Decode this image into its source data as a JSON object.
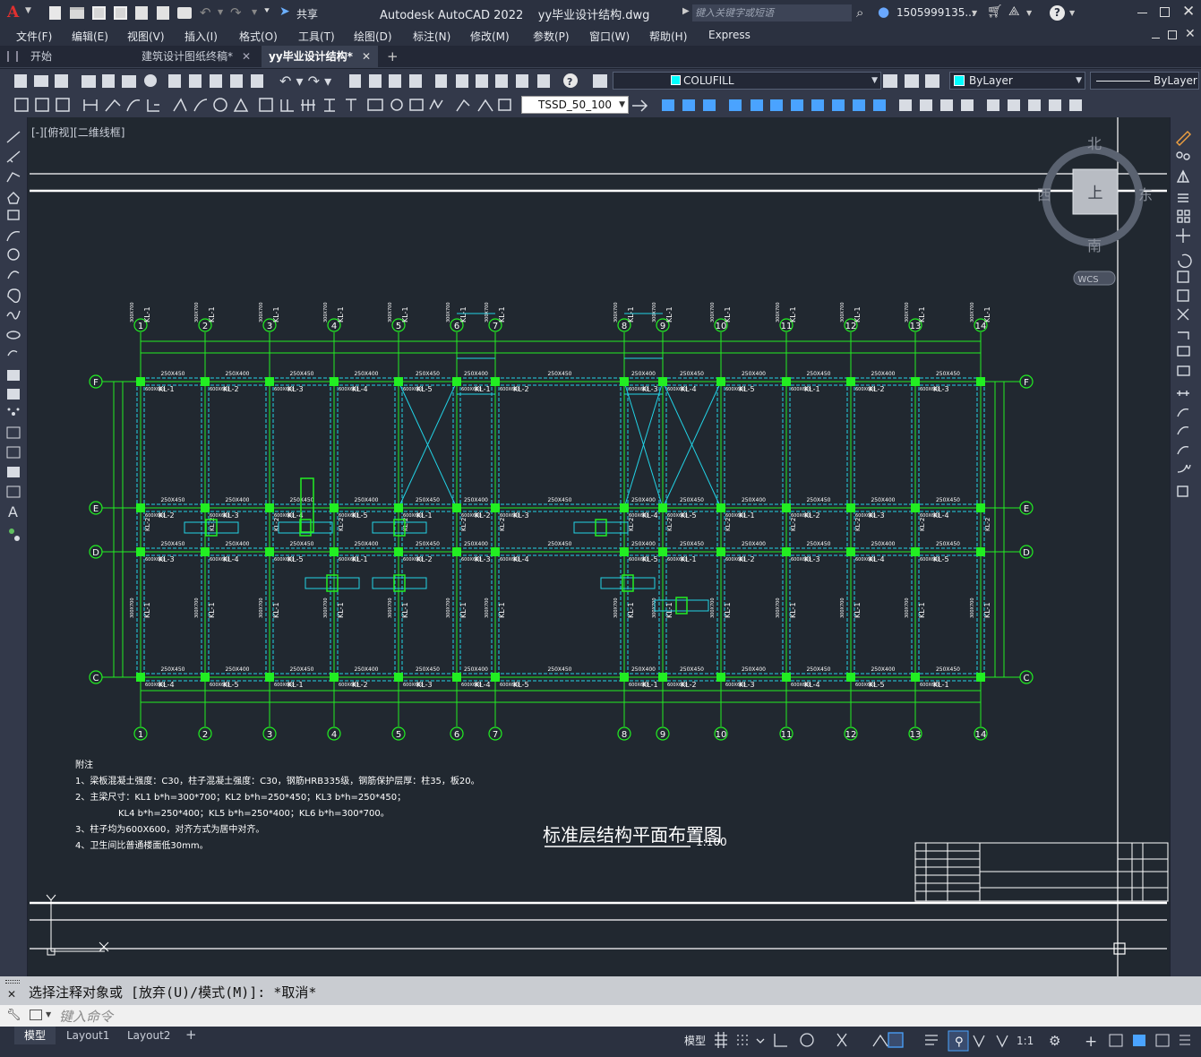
{
  "app": {
    "logo": "A",
    "title": "Autodesk AutoCAD 2022    yy毕业设计结构.dwg",
    "search_placeholder": "键入关键字或短语",
    "user": "1505999135...",
    "share": "共享"
  },
  "menu": [
    "文件(F)",
    "编辑(E)",
    "视图(V)",
    "插入(I)",
    "格式(O)",
    "工具(T)",
    "绘图(D)",
    "标注(N)",
    "修改(M)",
    "参数(P)",
    "窗口(W)",
    "帮助(H)",
    "Express"
  ],
  "tabs": [
    {
      "label": "开始"
    },
    {
      "label": "建筑设计图纸终稿*"
    },
    {
      "label": "yy毕业设计结构*"
    }
  ],
  "toolbar": {
    "layer": "COLUFILL",
    "color": "ByLayer",
    "linetype": "ByLayer",
    "dimstyle": "TSSD_50_100"
  },
  "viewport": {
    "label": "[-][俯视][二维线框]"
  },
  "viewcube": {
    "north": "北",
    "south": "南",
    "east": "东",
    "west": "西",
    "face": "上",
    "wcs": "WCS"
  },
  "drawing": {
    "title": "标准层结构平面布置图",
    "scale": "1:100",
    "grid_cols": [
      "1",
      "2",
      "3",
      "4",
      "5",
      "6",
      "7",
      "8",
      "9",
      "10",
      "11",
      "12",
      "13",
      "14"
    ],
    "grid_rows": [
      "F",
      "E",
      "D",
      "C"
    ],
    "notes": [
      "附注",
      "1、梁板混凝土强度：C30，柱子混凝土强度：C30，钢筋HRB335级，钢筋保护层厚：柱35，板20。",
      "2、主梁尺寸：KL1 b*h=300*700；KL2 b*h=250*450；KL3 b*h=250*450；",
      "KL4 b*h=250*400；KL5 b*h=250*400；KL6 b*h=300*700。",
      "3、柱子均为600X600，对齐方式为居中对齐。",
      "4、卫生间比普通楼面低30mm。"
    ],
    "beam_labels": [
      "KL-1",
      "KL-2",
      "KL-3",
      "KL-4",
      "KL-5"
    ],
    "section_labels": [
      "250X450",
      "300X700",
      "250X400",
      "600X600"
    ]
  },
  "command": {
    "history": "选择注释对象或 [放弃(U)/模式(M)]: *取消*",
    "placeholder": "键入命令"
  },
  "layout_tabs": [
    "模型",
    "Layout1",
    "Layout2"
  ],
  "status": {
    "model": "模型",
    "scale": "1:1"
  }
}
